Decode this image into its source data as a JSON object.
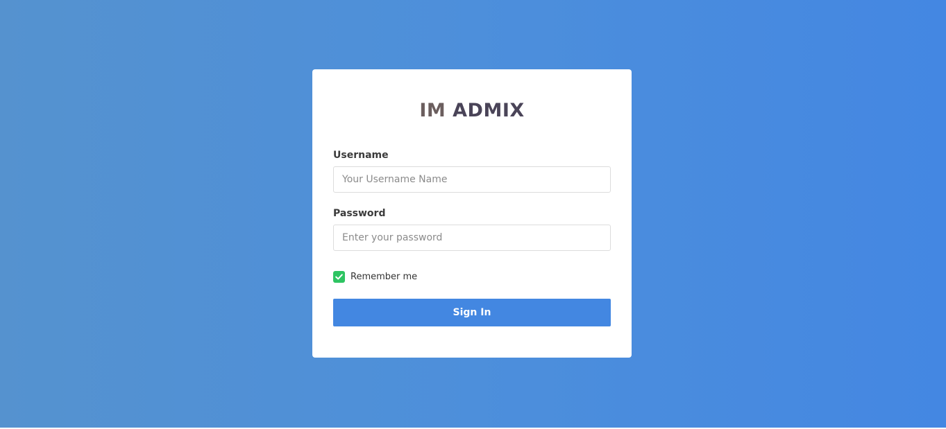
{
  "logo": {
    "part1": "IM",
    "part2": "ADMIX"
  },
  "form": {
    "username_label": "Username",
    "username_placeholder": "Your Username Name",
    "username_value": "",
    "password_label": "Password",
    "password_placeholder": "Enter your password",
    "password_value": "",
    "remember_label": "Remember me",
    "remember_checked": true,
    "submit_label": "Sign In"
  },
  "colors": {
    "background_start": "#5592cf",
    "background_end": "#4487e2",
    "card": "#ffffff",
    "logo_im": "#6b5e5e",
    "logo_admix": "#4a4458",
    "checkbox": "#2ec462",
    "button": "#4387e1"
  },
  "icons": {
    "checkbox": "check-icon"
  }
}
